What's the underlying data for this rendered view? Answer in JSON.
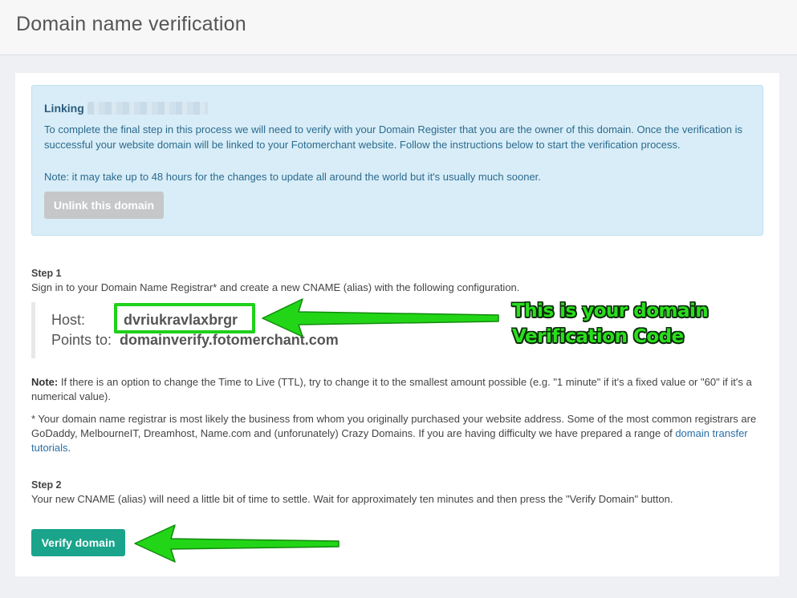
{
  "header": {
    "title": "Domain name verification"
  },
  "alert": {
    "linking_label": "Linking",
    "paragraph": "To complete the final step in this process we will need to verify with your Domain Register that you are the owner of this domain. Once the verification is successful your website domain will be linked to your Fotomerchant website. Follow the instructions below to start the verification process.",
    "note": "Note: it may take up to 48 hours for the changes to update all around the world but it's usually much sooner.",
    "unlink_label": "Unlink this domain"
  },
  "step1": {
    "label": "Step 1",
    "text": "Sign in to your Domain Name Registrar* and create a new CNAME (alias) with the following configuration.",
    "host_label": "Host:",
    "host_value": "dvriukravlaxbrgr",
    "points_label": "Points to:",
    "points_value": "domainverify.fotomerchant.com"
  },
  "notes": {
    "ttl_bold": "Note:",
    "ttl_text": " If there is an option to change the Time to Live (TTL), try to change it to the smallest amount possible (e.g. \"1 minute\" if it's a fixed value or \"60\" if it's a numerical value).",
    "registrar_text": "* Your domain name registrar is most likely the business from whom you originally purchased your website address. Some of the most common registrars are GoDaddy, MelbourneIT, Dreamhost, Name.com and (unforunately) Crazy Domains. If you are having difficulty we have prepared a range of ",
    "registrar_link": "domain transfer tutorials",
    "registrar_end": "."
  },
  "step2": {
    "label": "Step 2",
    "text": "Your new CNAME (alias) will need a little bit of time to settle. Wait for approximately ten minutes and then press the \"Verify Domain\" button.",
    "verify_label": "Verify domain"
  },
  "annotation": {
    "line1": "This is your domain",
    "line2": "Verification Code",
    "color": "#2adf1c"
  },
  "colors": {
    "alert_bg": "#d8edf7",
    "verify_button": "#19a48b",
    "unlink_button": "#c5c7c9",
    "highlight_green": "#1fd11a"
  }
}
